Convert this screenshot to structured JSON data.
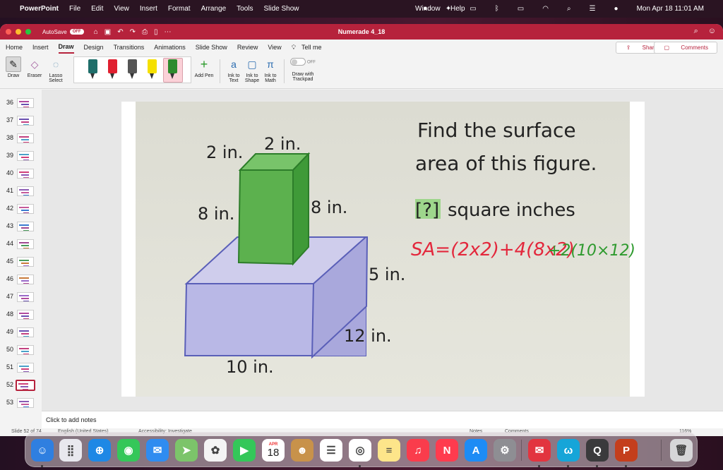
{
  "menubar": {
    "app": "PowerPoint",
    "items": [
      "File",
      "Edit",
      "View",
      "Insert",
      "Format",
      "Arrange",
      "Tools",
      "Slide Show"
    ],
    "right_items": [
      "Window",
      "Help"
    ],
    "datetime": "Mon Apr 18  11:01 AM"
  },
  "titlebar": {
    "autosave_label": "AutoSave",
    "autosave_state": "OFF",
    "doc_title": "Numerade 4_18"
  },
  "tabs": [
    "Home",
    "Insert",
    "Draw",
    "Design",
    "Transitions",
    "Animations",
    "Slide Show",
    "Review",
    "View",
    "Tell me"
  ],
  "active_tab": "Draw",
  "share_label": "Share",
  "comments_label": "Comments",
  "ribbon": {
    "draw": "Draw",
    "eraser": "Eraser",
    "lasso_l1": "Lasso",
    "lasso_l2": "Select",
    "add_pen": "Add Pen",
    "ink_text_l1": "Ink to",
    "ink_text_l2": "Text",
    "ink_shape_l1": "Ink to",
    "ink_shape_l2": "Shape",
    "ink_math_l1": "Ink to",
    "ink_math_l2": "Math",
    "trackpad_toggle": "OFF",
    "trackpad_l1": "Draw with",
    "trackpad_l2": "Trackpad",
    "pen_colors": [
      "#1f6e6a",
      "#e02030",
      "#555555",
      "#f5e000",
      "#2e8b2e"
    ]
  },
  "thumbnails": [
    {
      "num": "36"
    },
    {
      "num": "37"
    },
    {
      "num": "38"
    },
    {
      "num": "39"
    },
    {
      "num": "40"
    },
    {
      "num": "41"
    },
    {
      "num": "42"
    },
    {
      "num": "43"
    },
    {
      "num": "44"
    },
    {
      "num": "45"
    },
    {
      "num": "46"
    },
    {
      "num": "47"
    },
    {
      "num": "48"
    },
    {
      "num": "49"
    },
    {
      "num": "50"
    },
    {
      "num": "51"
    },
    {
      "num": "52"
    },
    {
      "num": "53"
    }
  ],
  "selected_slide": "52",
  "slide": {
    "q_line1": "Find the surface",
    "q_line2": "area of this figure.",
    "answer_box": "[?]",
    "answer_unit": "square inches",
    "dim_top_left": "2 in.",
    "dim_top_right": "2 in.",
    "dim_height_left": "8 in.",
    "dim_height_right": "8 in.",
    "dim_depth": "5 in.",
    "dim_width": "12 in.",
    "dim_length": "10 in.",
    "ink_red": "SA=(2x2)+4(8x2)",
    "ink_green": "+2(10×12)"
  },
  "notes_placeholder": "Click to add notes",
  "status_left": "Slide 52 of 74",
  "status_lang": "English (United States)",
  "status_access": "Accessibility: Investigate",
  "status_notes": "Notes",
  "status_comments": "Comments",
  "status_zoom": "116%",
  "dock": {
    "calendar_month": "APR",
    "calendar_day": "18",
    "apps": [
      "finder-icon",
      "launchpad-icon",
      "safari-icon",
      "messages-icon",
      "mail-icon",
      "maps-icon",
      "photos-icon",
      "facetime-icon",
      "calendar-icon",
      "contacts-icon",
      "reminders-icon",
      "chrome-icon",
      "notes-icon",
      "music-icon",
      "news-icon",
      "appstore-icon",
      "settings-icon",
      "email-app-icon",
      "w-app-icon",
      "quicktime-icon",
      "powerpoint-icon",
      "trash-icon"
    ]
  }
}
